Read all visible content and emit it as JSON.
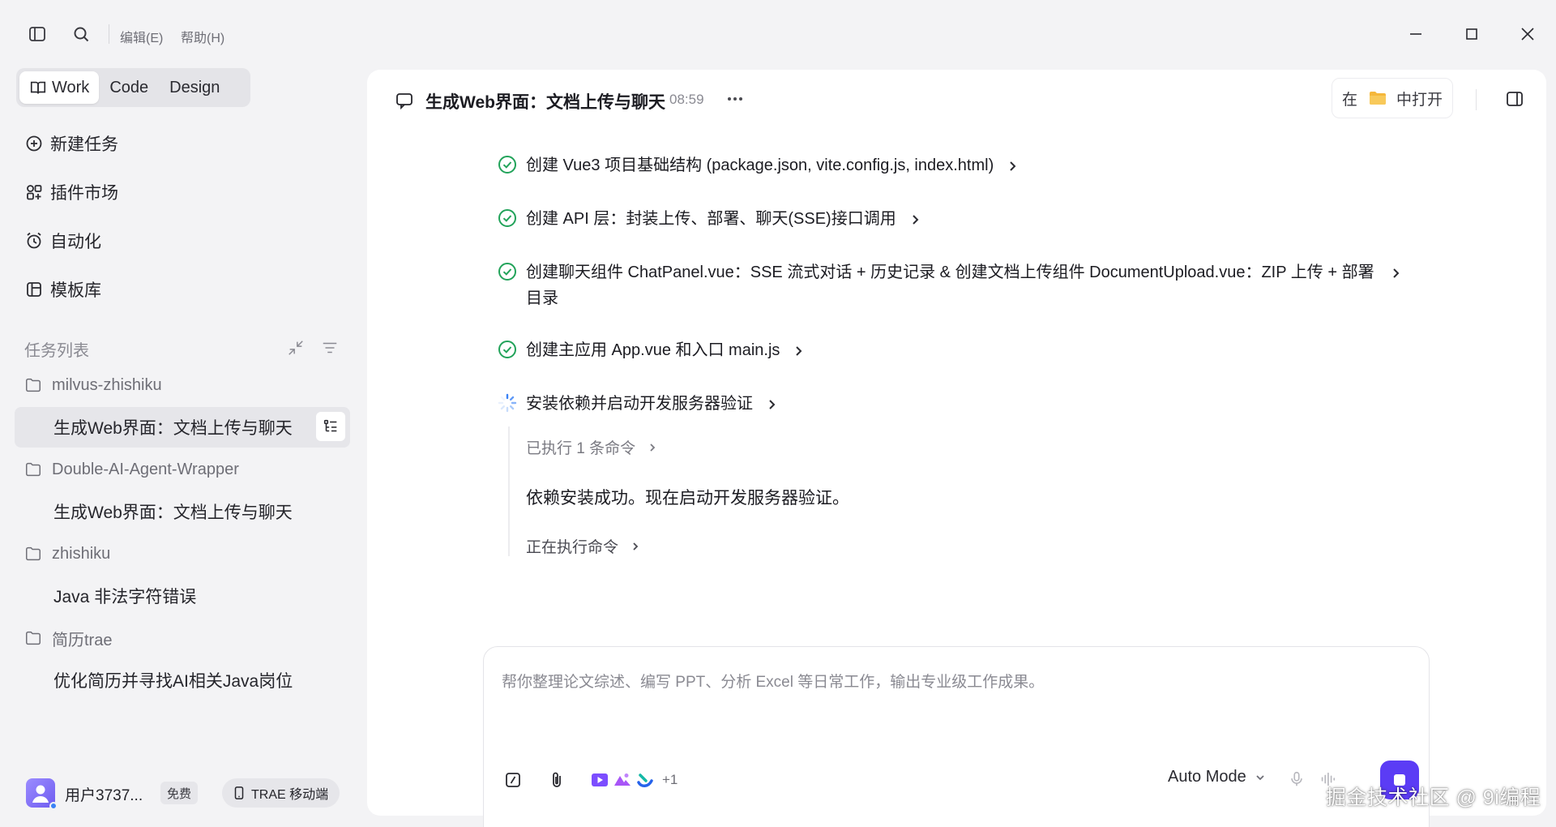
{
  "menubar": {
    "edit_label": "编辑(E)",
    "help_label": "帮助(H)"
  },
  "sidebar": {
    "modes": [
      {
        "label": "Work",
        "active": true
      },
      {
        "label": "Code",
        "active": false
      },
      {
        "label": "Design",
        "active": false
      }
    ],
    "nav": [
      {
        "label": "新建任务",
        "icon": "plus-circle-icon"
      },
      {
        "label": "插件市场",
        "icon": "plugin-icon"
      },
      {
        "label": "自动化",
        "icon": "alarm-clock-icon"
      },
      {
        "label": "模板库",
        "icon": "template-icon"
      }
    ],
    "task_list_heading": "任务列表",
    "groups": [
      {
        "folder": "milvus-zhishiku",
        "tasks": [
          "生成Web界面：文档上传与聊天"
        ]
      },
      {
        "folder": "Double-AI-Agent-Wrapper",
        "tasks": [
          "生成Web界面：文档上传与聊天"
        ]
      },
      {
        "folder": "zhishiku",
        "tasks": [
          "Java 非法字符错误"
        ]
      },
      {
        "folder": "简历trae",
        "tasks": [
          "优化简历并寻找AI相关Java岗位"
        ]
      }
    ],
    "user": {
      "name": "用户3737...",
      "plan_badge": "免费",
      "mobile_label": "TRAE 移动端"
    }
  },
  "chat": {
    "title": "生成Web界面：文档上传与聊天",
    "time": "08:59",
    "open_in_prefix": "在",
    "open_in_suffix": "中打开",
    "steps": [
      {
        "status": "done",
        "text": "创建 Vue3 项目基础结构 (package.json, vite.config.js, index.html)"
      },
      {
        "status": "done",
        "text": "创建 API 层：封装上传、部署、聊天(SSE)接口调用"
      },
      {
        "status": "done",
        "text": "创建聊天组件 ChatPanel.vue：SSE 流式对话 + 历史记录 & 创建文档上传组件 DocumentUpload.vue：ZIP 上传 + 部署目录"
      },
      {
        "status": "done",
        "text": "创建主应用 App.vue 和入口 main.js"
      },
      {
        "status": "in-progress",
        "text": "安装依赖并启动开发服务器验证"
      }
    ],
    "sub": {
      "executed_label": "已执行 1 条命令",
      "message": "依赖安装成功。现在启动开发服务器验证。",
      "running_label": "正在执行命令"
    },
    "input": {
      "placeholder": "帮你整理论文综述、编写 PPT、分析 Excel 等日常工作，输出专业级工作成果。",
      "value": "",
      "more_tools": "+1",
      "mode": "Auto Mode"
    }
  },
  "watermark": "掘金技术社区 @ 9i编程",
  "colors": {
    "accent": "#5b3cf5",
    "success": "#22a35a",
    "folder": "#f5b73b"
  }
}
